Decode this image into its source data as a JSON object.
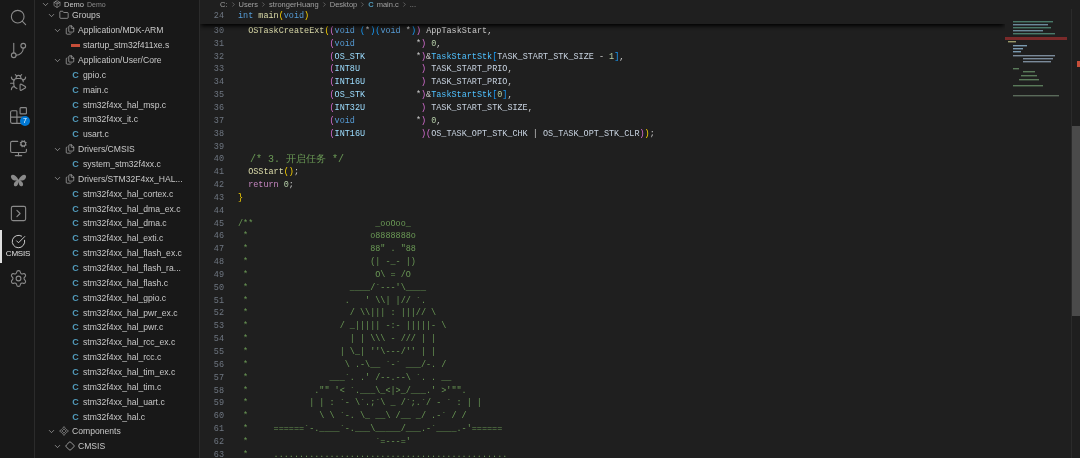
{
  "activity_bar": [
    {
      "kind": "search",
      "selected": false
    },
    {
      "kind": "source_control",
      "selected": false
    },
    {
      "kind": "run_debug",
      "selected": false
    },
    {
      "kind": "extensions",
      "selected": false,
      "badge": "7"
    },
    {
      "kind": "remote",
      "selected": false
    },
    {
      "kind": "butterfly",
      "selected": false
    },
    {
      "kind": "terminal",
      "selected": false
    },
    {
      "kind": "cmsis",
      "selected": true,
      "label": "CMSIS"
    },
    {
      "kind": "gear",
      "selected": false
    }
  ],
  "explorer": {
    "tree": [
      {
        "label": "Demo",
        "description": "Demo",
        "kind": "project",
        "expanded": true,
        "children": [
          {
            "label": "Groups",
            "kind": "folder",
            "expanded": true,
            "children": [
              {
                "label": "Application/MDK-ARM",
                "kind": "group",
                "expanded": true,
                "children": [
                  {
                    "label": "startup_stm32f411xe.s",
                    "kind": "asm"
                  }
                ]
              },
              {
                "label": "Application/User/Core",
                "kind": "group",
                "expanded": true,
                "children": [
                  {
                    "label": "gpio.c",
                    "kind": "c",
                    "glyph": "C"
                  },
                  {
                    "label": "main.c",
                    "kind": "c",
                    "glyph": "C"
                  },
                  {
                    "label": "stm32f4xx_hal_msp.c",
                    "kind": "c",
                    "glyph": "C"
                  },
                  {
                    "label": "stm32f4xx_it.c",
                    "kind": "c",
                    "glyph": "C"
                  },
                  {
                    "label": "usart.c",
                    "kind": "c",
                    "glyph": "C"
                  }
                ]
              },
              {
                "label": "Drivers/CMSIS",
                "kind": "group",
                "expanded": true,
                "children": [
                  {
                    "label": "system_stm32f4xx.c",
                    "kind": "c",
                    "glyph": "C"
                  }
                ]
              },
              {
                "label": "Drivers/STM32F4xx_HAL...",
                "kind": "group",
                "expanded": true,
                "children": [
                  {
                    "label": "stm32f4xx_hal_cortex.c",
                    "kind": "c",
                    "glyph": "C"
                  },
                  {
                    "label": "stm32f4xx_hal_dma_ex.c",
                    "kind": "c",
                    "glyph": "C"
                  },
                  {
                    "label": "stm32f4xx_hal_dma.c",
                    "kind": "c",
                    "glyph": "C"
                  },
                  {
                    "label": "stm32f4xx_hal_exti.c",
                    "kind": "c",
                    "glyph": "C"
                  },
                  {
                    "label": "stm32f4xx_hal_flash_ex.c",
                    "kind": "c",
                    "glyph": "C"
                  },
                  {
                    "label": "stm32f4xx_hal_flash_ra...",
                    "kind": "c",
                    "glyph": "C"
                  },
                  {
                    "label": "stm32f4xx_hal_flash.c",
                    "kind": "c",
                    "glyph": "C"
                  },
                  {
                    "label": "stm32f4xx_hal_gpio.c",
                    "kind": "c",
                    "glyph": "C"
                  },
                  {
                    "label": "stm32f4xx_hal_pwr_ex.c",
                    "kind": "c",
                    "glyph": "C"
                  },
                  {
                    "label": "stm32f4xx_hal_pwr.c",
                    "kind": "c",
                    "glyph": "C"
                  },
                  {
                    "label": "stm32f4xx_hal_rcc_ex.c",
                    "kind": "c",
                    "glyph": "C"
                  },
                  {
                    "label": "stm32f4xx_hal_rcc.c",
                    "kind": "c",
                    "glyph": "C"
                  },
                  {
                    "label": "stm32f4xx_hal_tim_ex.c",
                    "kind": "c",
                    "glyph": "C"
                  },
                  {
                    "label": "stm32f4xx_hal_tim.c",
                    "kind": "c",
                    "glyph": "C"
                  },
                  {
                    "label": "stm32f4xx_hal_uart.c",
                    "kind": "c",
                    "glyph": "C"
                  },
                  {
                    "label": "stm32f4xx_hal.c",
                    "kind": "c",
                    "glyph": "C"
                  }
                ]
              }
            ]
          },
          {
            "label": "Components",
            "kind": "components",
            "expanded": true,
            "children": [
              {
                "label": "CMSIS",
                "kind": "component",
                "expanded": true
              }
            ]
          }
        ]
      }
    ]
  },
  "breadcrumb": [
    {
      "text": "C:"
    },
    {
      "text": "Users"
    },
    {
      "text": "strongerHuang"
    },
    {
      "text": "Desktop"
    },
    {
      "text": "main.c",
      "glyph": "C"
    },
    {
      "text": "..."
    }
  ],
  "editor": {
    "sticky": [
      {
        "number": "24",
        "tokens": [
          {
            "text": "int",
            "kind": "kw"
          },
          {
            "text": " main",
            "kind": "fn"
          },
          {
            "text": "(",
            "kind": "br1"
          },
          {
            "text": "void",
            "kind": "kw"
          },
          {
            "text": ")",
            "kind": "br1"
          }
        ]
      }
    ],
    "lines": [
      {
        "number": "30",
        "tokens": [
          {
            "text": "  OSTaskCreateExt",
            "kind": "fn"
          },
          {
            "text": "(",
            "kind": "br1"
          },
          {
            "text": "(",
            "kind": "br2"
          },
          {
            "text": "void",
            "kind": "kw"
          },
          {
            "text": " (",
            "kind": "br3"
          },
          {
            "text": "*",
            "kind": "plain"
          },
          {
            "text": ")(",
            "kind": "br3"
          },
          {
            "text": "void",
            "kind": "kw"
          },
          {
            "text": " *",
            "kind": "plain"
          },
          {
            "text": ")",
            "kind": "br3"
          },
          {
            "text": ")",
            "kind": "br2"
          },
          {
            "text": " AppTaskStart,",
            "kind": "plain"
          }
        ]
      },
      {
        "number": "31",
        "tokens": [
          {
            "text": "                  (",
            "kind": "br2"
          },
          {
            "text": "void",
            "kind": "kw"
          },
          {
            "text": "            *",
            "kind": "plain"
          },
          {
            "text": ")",
            "kind": "br2"
          },
          {
            "text": " 0",
            "kind": "num"
          },
          {
            "text": ",",
            "kind": "plain"
          }
        ]
      },
      {
        "number": "32",
        "tokens": [
          {
            "text": "                  (",
            "kind": "br2"
          },
          {
            "text": "OS_STK",
            "kind": "type"
          },
          {
            "text": "          *",
            "kind": "plain"
          },
          {
            "text": ")",
            "kind": "br2"
          },
          {
            "text": "&",
            "kind": "plain"
          },
          {
            "text": "TaskStartStk",
            "kind": "var"
          },
          {
            "text": "[",
            "kind": "br3"
          },
          {
            "text": "TASK_START_STK_SIZE",
            "kind": "macro"
          },
          {
            "text": " - ",
            "kind": "plain"
          },
          {
            "text": "1",
            "kind": "num"
          },
          {
            "text": "]",
            "kind": "br3"
          },
          {
            "text": ",",
            "kind": "plain"
          }
        ]
      },
      {
        "number": "33",
        "tokens": [
          {
            "text": "                  (",
            "kind": "br2"
          },
          {
            "text": "INT8U",
            "kind": "type"
          },
          {
            "text": "            )",
            "kind": "br2"
          },
          {
            "text": " TASK_START_PRIO",
            "kind": "macro"
          },
          {
            "text": ",",
            "kind": "plain"
          }
        ]
      },
      {
        "number": "34",
        "tokens": [
          {
            "text": "                  (",
            "kind": "br2"
          },
          {
            "text": "INT16U",
            "kind": "type"
          },
          {
            "text": "           )",
            "kind": "br2"
          },
          {
            "text": " TASK_START_PRIO",
            "kind": "macro"
          },
          {
            "text": ",",
            "kind": "plain"
          }
        ]
      },
      {
        "number": "35",
        "tokens": [
          {
            "text": "                  (",
            "kind": "br2"
          },
          {
            "text": "OS_STK",
            "kind": "type"
          },
          {
            "text": "          *",
            "kind": "plain"
          },
          {
            "text": ")",
            "kind": "br2"
          },
          {
            "text": "&",
            "kind": "plain"
          },
          {
            "text": "TaskStartStk",
            "kind": "var"
          },
          {
            "text": "[",
            "kind": "br3"
          },
          {
            "text": "0",
            "kind": "num"
          },
          {
            "text": "]",
            "kind": "br3"
          },
          {
            "text": ",",
            "kind": "plain"
          }
        ]
      },
      {
        "number": "36",
        "tokens": [
          {
            "text": "                  (",
            "kind": "br2"
          },
          {
            "text": "INT32U",
            "kind": "type"
          },
          {
            "text": "           )",
            "kind": "br2"
          },
          {
            "text": " TASK_START_STK_SIZE",
            "kind": "macro"
          },
          {
            "text": ",",
            "kind": "plain"
          }
        ]
      },
      {
        "number": "37",
        "tokens": [
          {
            "text": "                  (",
            "kind": "br2"
          },
          {
            "text": "void",
            "kind": "kw"
          },
          {
            "text": "            *",
            "kind": "plain"
          },
          {
            "text": ")",
            "kind": "br2"
          },
          {
            "text": " 0",
            "kind": "num"
          },
          {
            "text": ",",
            "kind": "plain"
          }
        ]
      },
      {
        "number": "38",
        "tokens": [
          {
            "text": "                  (",
            "kind": "br2"
          },
          {
            "text": "INT16U",
            "kind": "type"
          },
          {
            "text": "           )(",
            "kind": "br2"
          },
          {
            "text": "OS_TASK_OPT_STK_CHK",
            "kind": "macro"
          },
          {
            "text": " | ",
            "kind": "plain"
          },
          {
            "text": "OS_TASK_OPT_STK_CLR",
            "kind": "macro"
          },
          {
            "text": ")",
            "kind": "br2"
          },
          {
            "text": ")",
            "kind": "br1"
          },
          {
            "text": ";",
            "kind": "plain"
          }
        ]
      },
      {
        "number": "39"
      },
      {
        "number": "40",
        "tokens": [
          {
            "text": "  /* 3. 开启任务 */",
            "kind": "comment"
          }
        ]
      },
      {
        "number": "41",
        "tokens": [
          {
            "text": "  OSStart",
            "kind": "fn"
          },
          {
            "text": "()",
            "kind": "br1"
          },
          {
            "text": ";",
            "kind": "plain"
          }
        ]
      },
      {
        "number": "42",
        "tokens": [
          {
            "text": "  return",
            "kind": "ctl"
          },
          {
            "text": " 0",
            "kind": "num"
          },
          {
            "text": ";",
            "kind": "plain"
          }
        ]
      },
      {
        "number": "43",
        "tokens": [
          {
            "text": "}",
            "kind": "br1"
          }
        ]
      },
      {
        "number": "44"
      },
      {
        "number": "45",
        "tokens": [
          {
            "text": "/**                        _ooOoo_",
            "kind": "comment"
          }
        ]
      },
      {
        "number": "46",
        "tokens": [
          {
            "text": " *                        o8888888o",
            "kind": "comment"
          }
        ]
      },
      {
        "number": "47",
        "tokens": [
          {
            "text": " *                        88\" . \"88",
            "kind": "comment"
          }
        ]
      },
      {
        "number": "48",
        "tokens": [
          {
            "text": " *                        (| -_- |)",
            "kind": "comment"
          }
        ]
      },
      {
        "number": "49",
        "tokens": [
          {
            "text": " *                         O\\ = /O",
            "kind": "comment"
          }
        ]
      },
      {
        "number": "50",
        "tokens": [
          {
            "text": " *                    ____/`---'\\____",
            "kind": "comment"
          }
        ]
      },
      {
        "number": "51",
        "tokens": [
          {
            "text": " *                   .   ' \\\\| |// `.",
            "kind": "comment"
          }
        ]
      },
      {
        "number": "52",
        "tokens": [
          {
            "text": " *                    / \\\\||| : |||// \\",
            "kind": "comment"
          }
        ]
      },
      {
        "number": "53",
        "tokens": [
          {
            "text": " *                  / _||||| -:- |||||- \\",
            "kind": "comment"
          }
        ]
      },
      {
        "number": "54",
        "tokens": [
          {
            "text": " *                    | | \\\\\\ - /// | |",
            "kind": "comment"
          }
        ]
      },
      {
        "number": "55",
        "tokens": [
          {
            "text": " *                  | \\_| ''\\---/'' | |",
            "kind": "comment"
          }
        ]
      },
      {
        "number": "56",
        "tokens": [
          {
            "text": " *                   \\ .-\\__ `-` ___/-. /",
            "kind": "comment"
          }
        ]
      },
      {
        "number": "57",
        "tokens": [
          {
            "text": " *                ___`. .' /--.--\\ `. . __",
            "kind": "comment"
          }
        ]
      },
      {
        "number": "58",
        "tokens": [
          {
            "text": " *             .\"\" '< `.___\\_<|>_/___.' >'\"\".",
            "kind": "comment"
          }
        ]
      },
      {
        "number": "59",
        "tokens": [
          {
            "text": " *            | | : `- \\`.;`\\ _ /`;.`/ - ` : | |",
            "kind": "comment"
          }
        ]
      },
      {
        "number": "60",
        "tokens": [
          {
            "text": " *              \\ \\ `-. \\_ __\\ /__ _/ .-` / /",
            "kind": "comment"
          }
        ]
      },
      {
        "number": "61",
        "tokens": [
          {
            "text": " *     ======`-.____`-.___\\_____/___.-`____.-'======",
            "kind": "comment"
          }
        ]
      },
      {
        "number": "62",
        "tokens": [
          {
            "text": " *                         `=---='",
            "kind": "comment"
          }
        ]
      },
      {
        "number": "63",
        "tokens": [
          {
            "text": " *     ..............................................",
            "kind": "comment"
          }
        ]
      }
    ]
  }
}
